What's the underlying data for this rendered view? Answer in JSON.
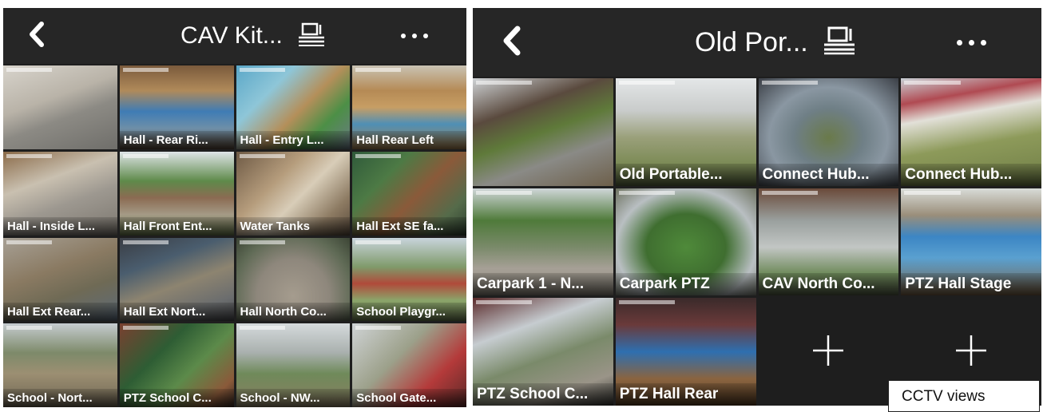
{
  "left_view": {
    "title": "CAV Kit...",
    "icons": {
      "back": "back-chevron-icon",
      "screen": "screen-toggle-icon",
      "more": "more-dots-icon"
    },
    "cameras": [
      {
        "label": ""
      },
      {
        "label": "Hall - Rear Ri..."
      },
      {
        "label": "Hall - Entry L..."
      },
      {
        "label": "Hall Rear Left"
      },
      {
        "label": "Hall - Inside L..."
      },
      {
        "label": "Hall Front Ent..."
      },
      {
        "label": "Water Tanks"
      },
      {
        "label": "Hall Ext SE fa..."
      },
      {
        "label": "Hall Ext Rear..."
      },
      {
        "label": "Hall Ext Nort..."
      },
      {
        "label": "Hall North Co..."
      },
      {
        "label": "School Playgr..."
      },
      {
        "label": "School - Nort..."
      },
      {
        "label": "PTZ School C..."
      },
      {
        "label": "School - NW..."
      },
      {
        "label": "School Gate..."
      }
    ]
  },
  "right_view": {
    "title": "Old Por...",
    "icons": {
      "back": "back-chevron-icon",
      "screen": "screen-toggle-icon",
      "more": "more-dots-icon",
      "add": "plus-icon"
    },
    "cameras": [
      {
        "label": ""
      },
      {
        "label": "Old Portable..."
      },
      {
        "label": "Connect Hub..."
      },
      {
        "label": "Connect Hub..."
      },
      {
        "label": "Carpark 1 - N..."
      },
      {
        "label": "Carpark PTZ"
      },
      {
        "label": "CAV North Co..."
      },
      {
        "label": "PTZ Hall Stage"
      },
      {
        "label": "PTZ School C..."
      },
      {
        "label": "PTZ Hall Rear"
      }
    ],
    "empty_slots": 2
  },
  "annotation": {
    "text": "CCTV views"
  }
}
